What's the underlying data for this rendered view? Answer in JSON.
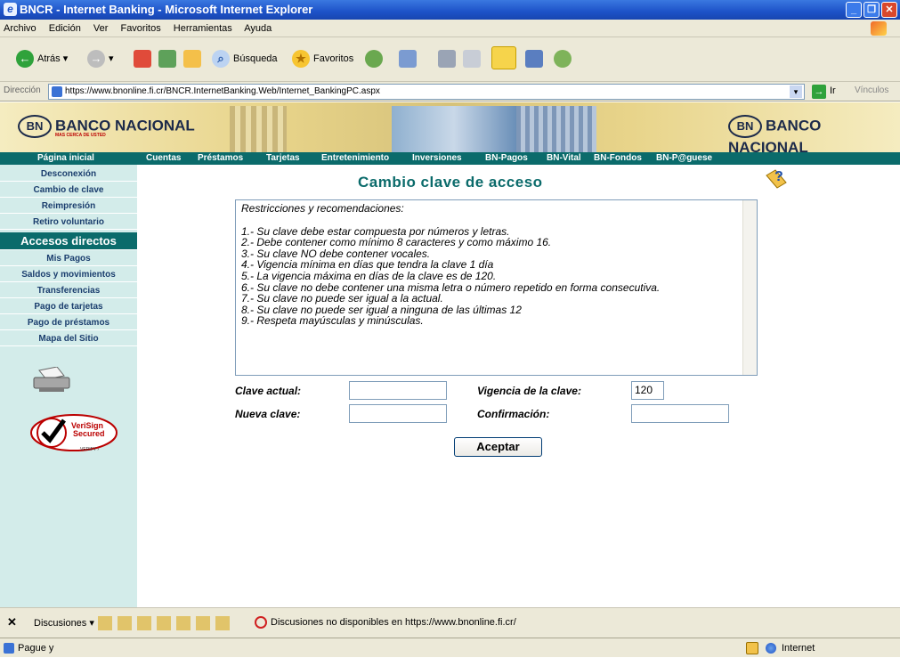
{
  "window": {
    "title": "BNCR - Internet Banking - Microsoft Internet Explorer"
  },
  "menu": [
    "Archivo",
    "Edición",
    "Ver",
    "Favoritos",
    "Herramientas",
    "Ayuda"
  ],
  "toolbar": {
    "back": "Atrás",
    "search": "Búsqueda",
    "favorites": "Favoritos"
  },
  "address": {
    "label": "Dirección",
    "url": "https://www.bnonline.fi.cr/BNCR.InternetBanking.Web/Internet_BankingPC.aspx",
    "go": "Ir",
    "links": "Vínculos"
  },
  "banner": {
    "logo_text": "BANCO NACIONAL",
    "tagline": "MAS CERCA DE USTED",
    "logo_mark": "BN"
  },
  "nav": [
    "Página inicial",
    "Cuentas",
    "Préstamos",
    "Tarjetas",
    "Entretenimiento",
    "Inversiones",
    "BN-Pagos",
    "BN-Vital",
    "BN-Fondos",
    "BN-P@guese"
  ],
  "sidebar": {
    "items": [
      "Desconexión",
      "Cambio de clave",
      "Reimpresión",
      "Retiro voluntario"
    ],
    "section": "Accesos directos",
    "shortcuts": [
      "Mis Pagos",
      "Saldos y movimientos",
      "Transferencias",
      "Pago de tarjetas",
      "Pago de préstamos",
      "Mapa del Sitio"
    ],
    "verisign": {
      "line1": "VeriSign",
      "line2": "Secured",
      "line3": "VERIFY ›"
    }
  },
  "form": {
    "title": "Cambio clave de acceso",
    "restrictions_heading": "Restricciones y recomendaciones:",
    "restrictions": [
      "1.- Su clave debe estar compuesta por números y letras.",
      "2.- Debe contener como mínimo 8 caracteres y como máximo 16.",
      "3.- Su clave NO debe contener vocales.",
      "4.- Vigencia mínima en días que tendra la clave 1 día",
      "5.- La vigencia máxima en días de la clave es de 120.",
      "6.- Su clave no debe contener una misma letra o número repetido en forma consecutiva.",
      "7.- Su clave no puede ser igual a la actual.",
      "8.- Su clave no puede ser igual a ninguna de las últimas 12",
      "9.- Respeta mayúsculas y minúsculas."
    ],
    "current_label": "Clave actual:",
    "current_value": "",
    "new_label": "Nueva clave:",
    "new_value": "",
    "validity_label": "Vigencia de la clave:",
    "validity_value": "120",
    "confirm_label": "Confirmación:",
    "confirm_value": "",
    "accept": "Aceptar"
  },
  "discussions": {
    "label": "Discusiones",
    "message": "Discusiones no disponibles en https://www.bnonline.fi.cr/"
  },
  "status": {
    "text": "Pague y",
    "zone": "Internet"
  },
  "colors": {
    "teal": "#0b6b6b",
    "sidebar_bg": "#d3ecea",
    "title_blue": "#1d52c8"
  }
}
